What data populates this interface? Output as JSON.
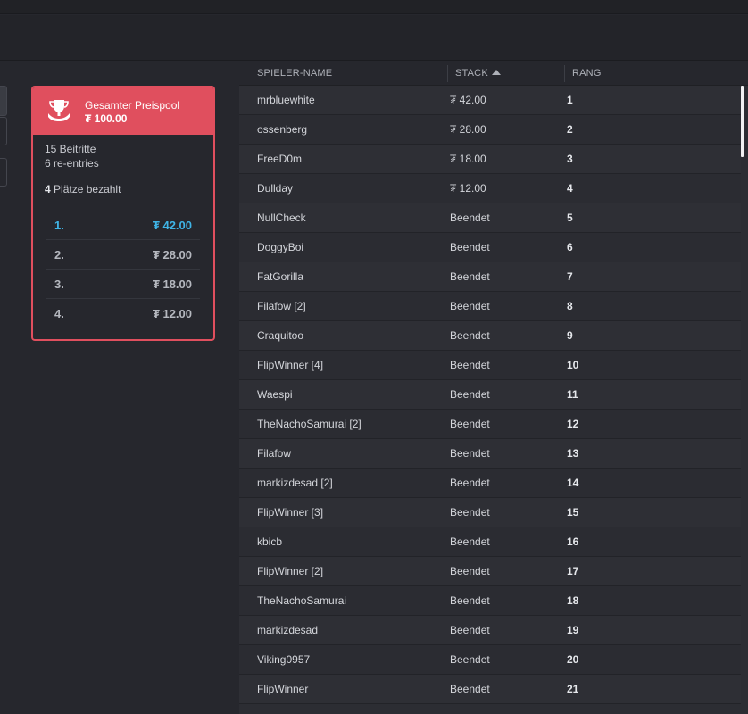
{
  "prize_pool": {
    "title": "Gesamter Preispool",
    "amount": "₮ 100.00",
    "entries": "15 Beitritte",
    "reentries": "6 re-entries",
    "paid_count": "4",
    "paid_label": "Plätze bezahlt",
    "payouts": [
      {
        "place": "1.",
        "amount": "₮ 42.00"
      },
      {
        "place": "2.",
        "amount": "₮ 28.00"
      },
      {
        "place": "3.",
        "amount": "₮ 18.00"
      },
      {
        "place": "4.",
        "amount": "₮ 12.00"
      }
    ]
  },
  "table": {
    "headers": {
      "name": "SPIELER-NAME",
      "stack": "STACK",
      "rank": "RANG"
    },
    "sort_icon": "chevron-up-icon",
    "rows": [
      {
        "name": "mrbluewhite",
        "stack": "₮ 42.00",
        "rank": "1"
      },
      {
        "name": "ossenberg",
        "stack": "₮ 28.00",
        "rank": "2"
      },
      {
        "name": "FreeD0m",
        "stack": "₮ 18.00",
        "rank": "3"
      },
      {
        "name": "Dullday",
        "stack": "₮ 12.00",
        "rank": "4"
      },
      {
        "name": "NullCheck",
        "stack": "Beendet",
        "rank": "5"
      },
      {
        "name": "DoggyBoi",
        "stack": "Beendet",
        "rank": "6"
      },
      {
        "name": "FatGorilla",
        "stack": "Beendet",
        "rank": "7"
      },
      {
        "name": "Filafow [2]",
        "stack": "Beendet",
        "rank": "8"
      },
      {
        "name": "Craquitoo",
        "stack": "Beendet",
        "rank": "9"
      },
      {
        "name": "FlipWinner [4]",
        "stack": "Beendet",
        "rank": "10"
      },
      {
        "name": "Waespi",
        "stack": "Beendet",
        "rank": "11"
      },
      {
        "name": "TheNachoSamurai [2]",
        "stack": "Beendet",
        "rank": "12"
      },
      {
        "name": "Filafow",
        "stack": "Beendet",
        "rank": "13"
      },
      {
        "name": "markizdesad [2]",
        "stack": "Beendet",
        "rank": "14"
      },
      {
        "name": "FlipWinner [3]",
        "stack": "Beendet",
        "rank": "15"
      },
      {
        "name": "kbicb",
        "stack": "Beendet",
        "rank": "16"
      },
      {
        "name": "FlipWinner [2]",
        "stack": "Beendet",
        "rank": "17"
      },
      {
        "name": "TheNachoSamurai",
        "stack": "Beendet",
        "rank": "18"
      },
      {
        "name": "markizdesad",
        "stack": "Beendet",
        "rank": "19"
      },
      {
        "name": "Viking0957",
        "stack": "Beendet",
        "rank": "20"
      },
      {
        "name": "FlipWinner",
        "stack": "Beendet",
        "rank": "21"
      }
    ]
  },
  "colors": {
    "accent": "#e04f5e",
    "first_place": "#3fb4e6"
  }
}
